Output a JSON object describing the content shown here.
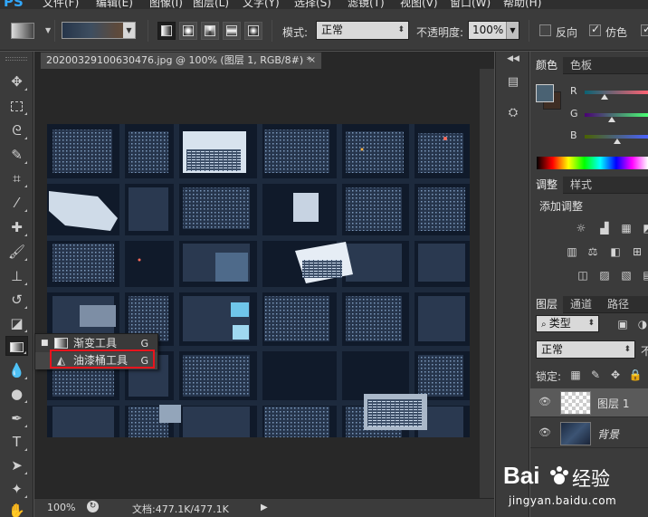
{
  "menubar": {
    "logo": "PS",
    "items": [
      "文件(F)",
      "编辑(E)",
      "图像(I)",
      "图层(L)",
      "文字(Y)",
      "选择(S)",
      "滤镜(T)",
      "视图(V)",
      "窗口(W)",
      "帮助(H)"
    ]
  },
  "options": {
    "mode_label": "模式:",
    "mode_value": "正常",
    "opacity_label": "不透明度:",
    "opacity_value": "100%",
    "reverse_label": "反向",
    "dither_label": "仿色",
    "reverse_checked": false,
    "dither_checked": true
  },
  "document": {
    "tab_title": "20200329100630476.jpg @ 100% (图层 1, RGB/8#) *",
    "close_glyph": "×",
    "zoom": "100%",
    "doc_info": "文档:477.1K/477.1K"
  },
  "flyout": {
    "items": [
      {
        "label": "渐变工具",
        "key": "G",
        "current": true
      },
      {
        "label": "油漆桶工具",
        "key": "G",
        "current": false
      }
    ]
  },
  "color_panel": {
    "tabs": [
      "颜色",
      "色板"
    ],
    "channels": [
      "R",
      "G",
      "B"
    ],
    "foreground": "#4a6273",
    "background": "#3f2e24"
  },
  "adjust_panel": {
    "tabs": [
      "调整",
      "样式"
    ],
    "add_label": "添加调整"
  },
  "layers_panel": {
    "tabs": [
      "图层",
      "通道",
      "路径"
    ],
    "filter_label": "类型",
    "blend_mode": "正常",
    "opacity_prefix": "不",
    "lock_label": "锁定:",
    "layers": [
      {
        "name": "图层 1",
        "selected": true
      },
      {
        "name": "背景",
        "selected": false
      }
    ]
  },
  "watermark": {
    "brand_left": "Bai",
    "brand_right": "经验",
    "url": "jingyan.baidu.com"
  }
}
